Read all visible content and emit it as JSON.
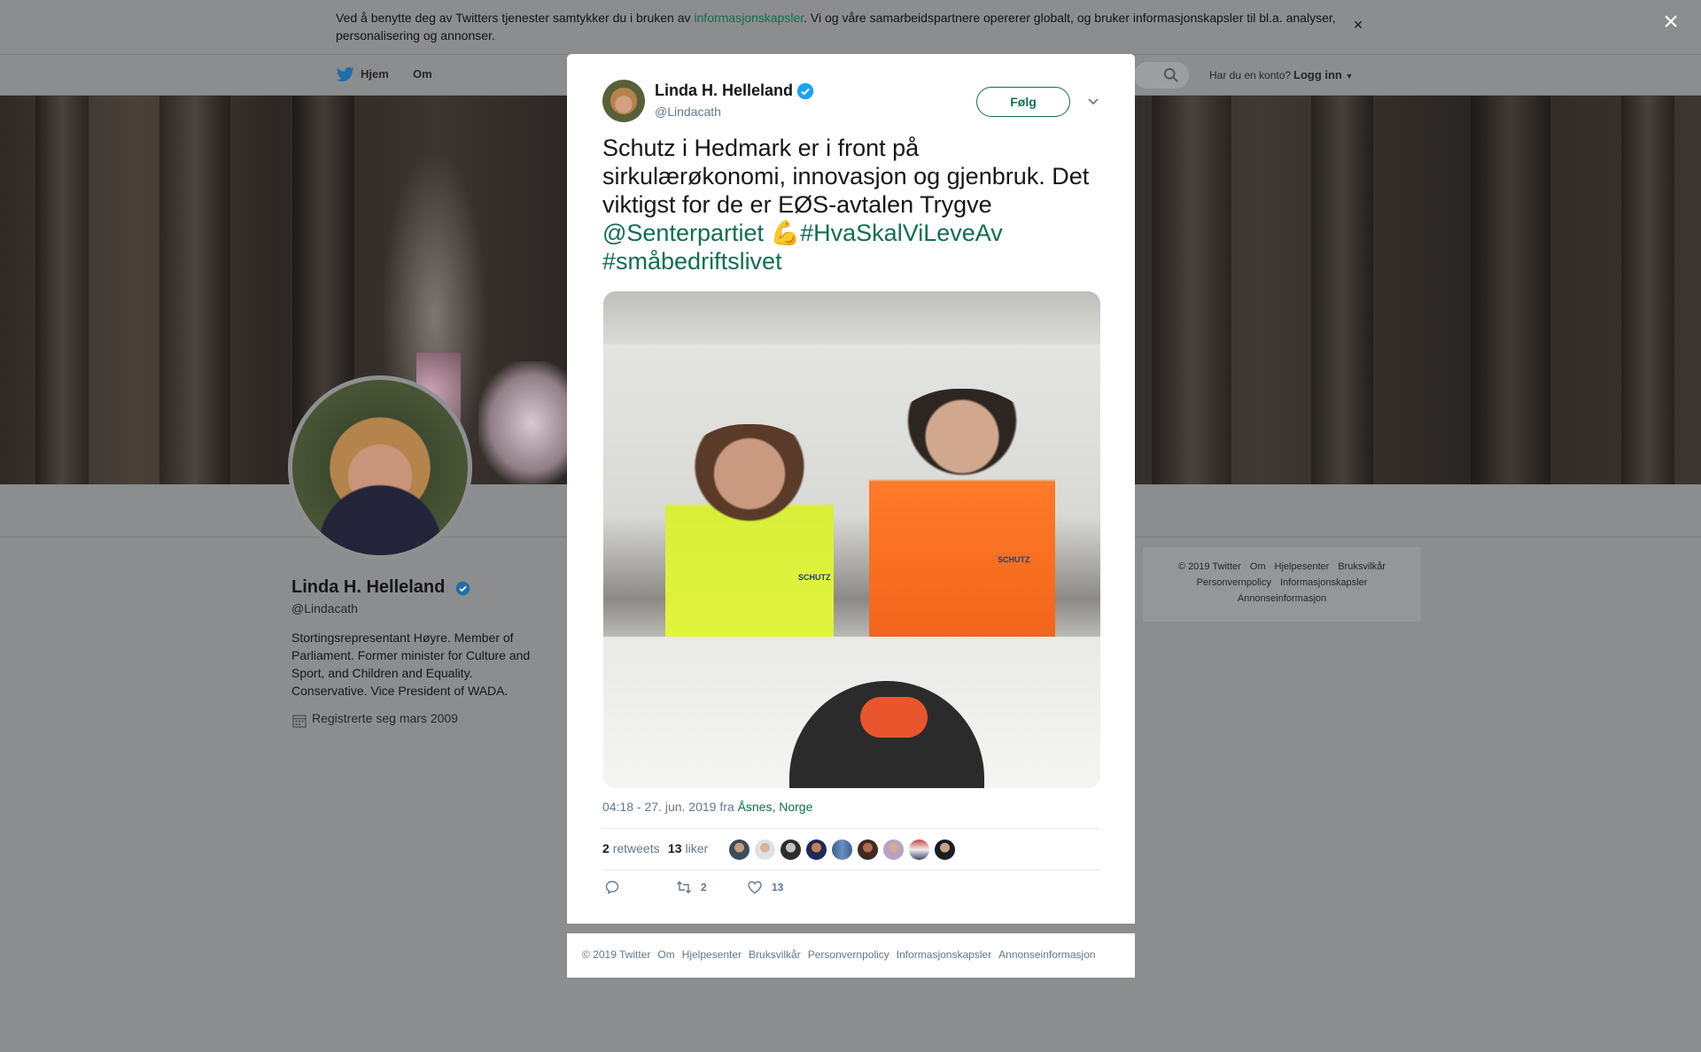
{
  "cookie": {
    "text_before": "Ved å benytte deg av Twitters tjenester samtykker du i bruken av ",
    "link": "informasjonskapsler",
    "text_after": ". Vi og våre samarbeidspartnere opererer globalt, og bruker informasjonskapsler til bl.a. analyser, personalisering og annonser.",
    "close": "×"
  },
  "page_close": "×",
  "nav": {
    "home": "Hjem",
    "about": "Om",
    "have_account": "Har du en konto?",
    "login": "Logg inn"
  },
  "profile": {
    "name": "Linda H. Helleland",
    "handle": "@Lindacath",
    "bio": "Stortingsrepresentant Høyre. Member of Parliament. Former minister for Culture and Sport, and Children and Equality. Conservative. Vice President of WADA.",
    "joined": "Registrerte seg mars 2009"
  },
  "side_footer": {
    "row1": [
      "© 2019 Twitter",
      "Om",
      "Hjelpesenter",
      "Bruksvilkår"
    ],
    "row2": [
      "Personvernpolicy",
      "Informasjonskapsler"
    ],
    "row3": [
      "Annonseinformasjon"
    ]
  },
  "tweet": {
    "author": "Linda H. Helleland",
    "handle": "@Lindacath",
    "follow": "Følg",
    "text": "Schutz i Hedmark er i front på sirkulærøkonomi, innovasjon og gjenbruk. Det viktigst for de er EØS-avtalen Trygve",
    "mention": "@Senterpartiet",
    "emoji": "💪",
    "hashtag1": "#HvaSkalViLeveAv",
    "hashtag2": "#småbedriftslivet",
    "time": "04:18 - 27. jun. 2019 fra ",
    "place": "Åsnes, Norge",
    "retweets_count": "2",
    "retweets_label": "retweets",
    "likes_count": "13",
    "likes_label": "liker",
    "action_retweets": "2",
    "action_likes": "13",
    "media_label_1": "SCHUTZ",
    "media_label_2": "SCHUTZ",
    "colors": {
      "accent": "#106f4e",
      "verified": "#1da1f2"
    }
  },
  "modal_footer": [
    "© 2019 Twitter",
    "Om",
    "Hjelpesenter",
    "Bruksvilkår",
    "Personvernpolicy",
    "Informasjonskapsler",
    "Annonseinformasjon"
  ]
}
